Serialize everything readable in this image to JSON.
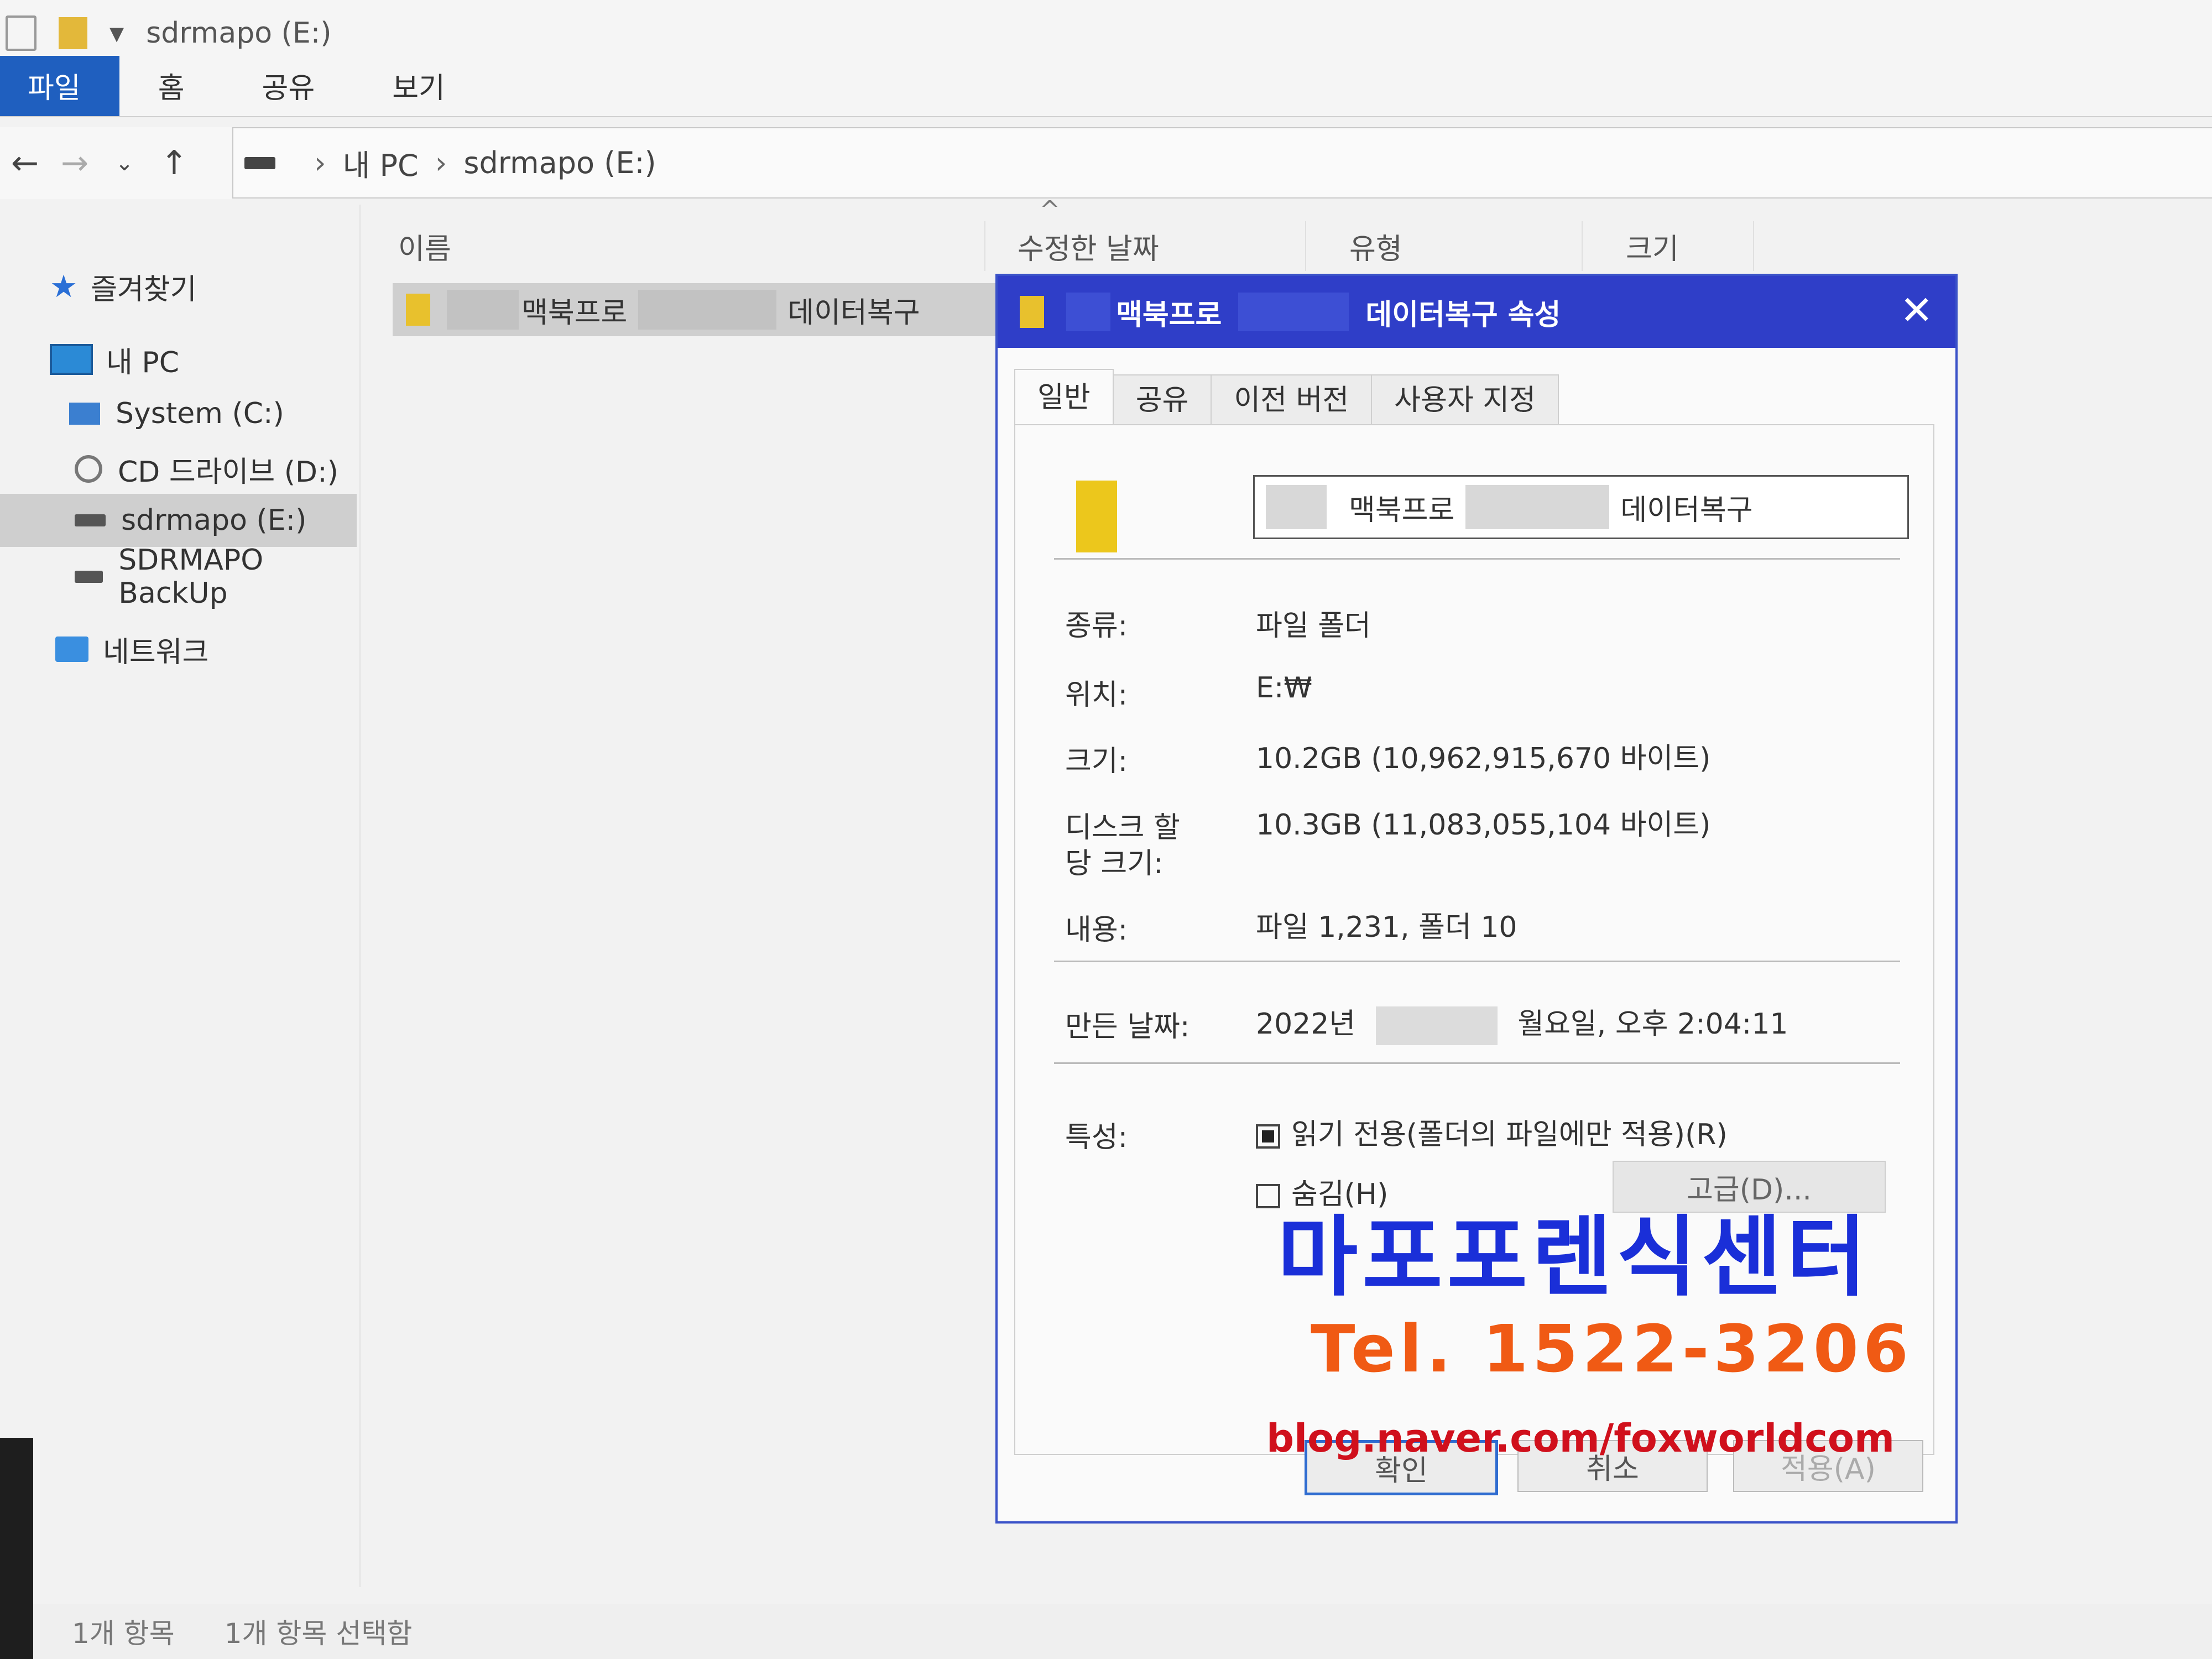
{
  "window": {
    "title": "sdrmapo (E:)"
  },
  "ribbon": {
    "tabs": [
      "파일",
      "홈",
      "공유",
      "보기"
    ]
  },
  "address": {
    "crumbs": [
      "내 PC",
      "sdrmapo (E:)"
    ]
  },
  "sidebar": {
    "items": [
      {
        "label": "즐겨찾기",
        "icon": "star-icon"
      },
      {
        "label": "내 PC",
        "icon": "computer-icon"
      },
      {
        "label": "System (C:)",
        "icon": "system-drive-icon"
      },
      {
        "label": "CD 드라이브 (D:)",
        "icon": "cd-drive-icon"
      },
      {
        "label": "sdrmapo (E:)",
        "icon": "drive-icon",
        "selected": true
      },
      {
        "label": "SDRMAPO BackUp",
        "icon": "drive-icon"
      },
      {
        "label": "네트워크",
        "icon": "network-icon"
      }
    ]
  },
  "file_list": {
    "columns": [
      "이름",
      "수정한 날짜",
      "유형",
      "크기"
    ],
    "rows": [
      {
        "name_part1": "맥북프로",
        "name_part2": "데이터복구"
      }
    ]
  },
  "dialog": {
    "title_part1": "맥북프로",
    "title_part2": "데이터복구 속성",
    "tabs": [
      "일반",
      "공유",
      "이전 버전",
      "사용자 지정"
    ],
    "name_part1": "맥북프로",
    "name_part2": "데이터복구",
    "labels": {
      "type": "종류:",
      "location": "위치:",
      "size": "크기:",
      "disk_size_line1": "디스크 할",
      "disk_size_line2": "당 크기:",
      "contents": "내용:",
      "created": "만든 날짜:",
      "attributes": "특성:"
    },
    "values": {
      "type": "파일 폴더",
      "location": "E:₩",
      "size": "10.2GB (10,962,915,670 바이트)",
      "disk_size": "10.3GB (11,083,055,104 바이트)",
      "contents": "파일 1,231, 폴더 10",
      "created_year": "2022년",
      "created_rest": "월요일, 오후 2:04:11"
    },
    "attr_readonly": "읽기 전용(폴더의 파일에만 적용)(R)",
    "attr_hidden": "숨김(H)",
    "advanced": "고급(D)...",
    "buttons": {
      "ok": "확인",
      "cancel": "취소",
      "apply": "적용(A)"
    }
  },
  "watermark": {
    "name": "마포포렌식센터",
    "tel": "Tel. 1522-3206",
    "blog": "blog.naver.com/foxworldcom"
  },
  "status": {
    "count": "1개 항목",
    "selected": "1개 항목 선택함"
  }
}
